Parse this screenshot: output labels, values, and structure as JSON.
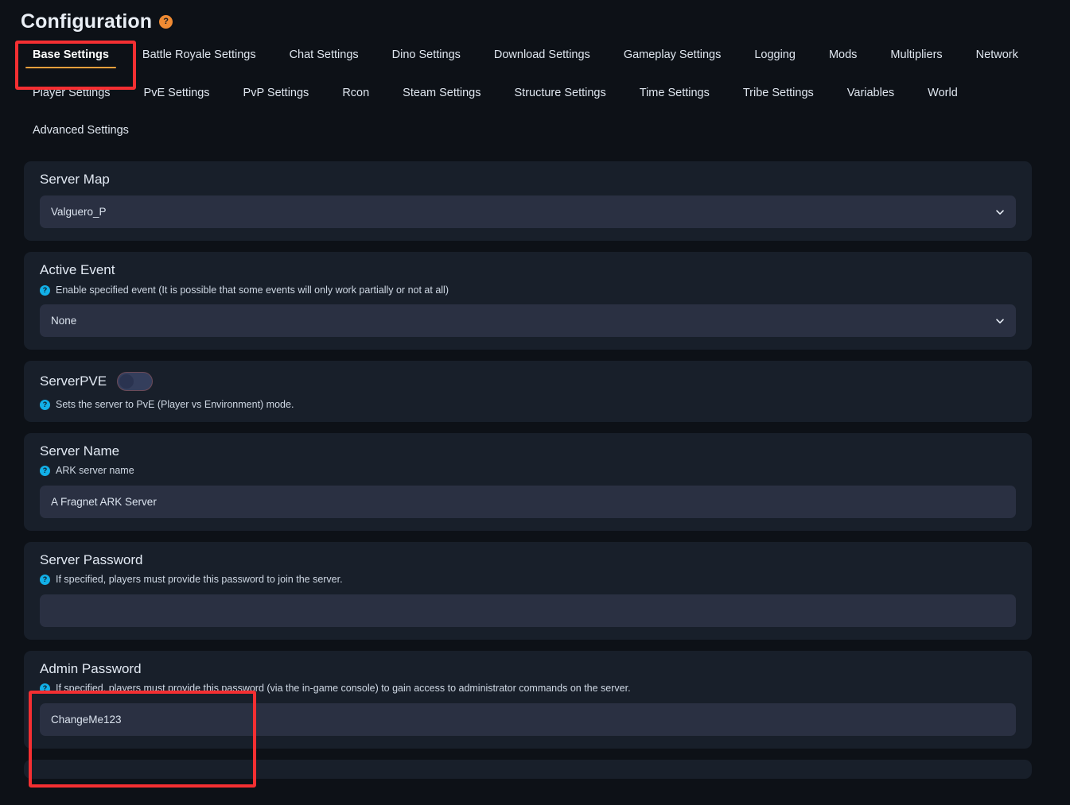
{
  "header": {
    "title": "Configuration",
    "help_icon": "question-mark-icon"
  },
  "tabs": [
    {
      "label": "Base Settings",
      "active": true
    },
    {
      "label": "Battle Royale Settings",
      "active": false
    },
    {
      "label": "Chat Settings",
      "active": false
    },
    {
      "label": "Dino Settings",
      "active": false
    },
    {
      "label": "Download Settings",
      "active": false
    },
    {
      "label": "Gameplay Settings",
      "active": false
    },
    {
      "label": "Logging",
      "active": false
    },
    {
      "label": "Mods",
      "active": false
    },
    {
      "label": "Multipliers",
      "active": false
    },
    {
      "label": "Network",
      "active": false
    },
    {
      "label": "Player Settings",
      "active": false
    },
    {
      "label": "PvE Settings",
      "active": false
    },
    {
      "label": "PvP Settings",
      "active": false
    },
    {
      "label": "Rcon",
      "active": false
    },
    {
      "label": "Steam Settings",
      "active": false
    },
    {
      "label": "Structure Settings",
      "active": false
    },
    {
      "label": "Time Settings",
      "active": false
    },
    {
      "label": "Tribe Settings",
      "active": false
    },
    {
      "label": "Variables",
      "active": false
    },
    {
      "label": "World",
      "active": false
    },
    {
      "label": "Advanced Settings",
      "active": false
    }
  ],
  "fields": {
    "server_map": {
      "label": "Server Map",
      "value": "Valguero_P",
      "icon": "chevron-down-icon"
    },
    "active_event": {
      "label": "Active Event",
      "description": "Enable specified event (It is possible that some events will only work partially or not at all)",
      "value": "None",
      "icon": "chevron-down-icon"
    },
    "server_pve": {
      "label": "ServerPVE",
      "description": "Sets the server to PvE (Player vs Environment) mode.",
      "toggle_state": "off"
    },
    "server_name": {
      "label": "Server Name",
      "description": "ARK server name",
      "value": "A Fragnet ARK Server",
      "placeholder": ""
    },
    "server_password": {
      "label": "Server Password",
      "description": "If specified, players must provide this password to join the server.",
      "value": "",
      "placeholder": ""
    },
    "admin_password": {
      "label": "Admin Password",
      "description": "If specified, players must provide this password (via the in-game console) to gain access to administrator commands on the server.",
      "value": "ChangeMe123",
      "placeholder": ""
    }
  },
  "colors": {
    "page_background": "#0d1117",
    "card_background": "#181f2a",
    "input_background": "#2a3042",
    "accent_orange": "#f3a03c",
    "help_blue": "#12b0e8",
    "annotation_red": "#f42f32"
  }
}
